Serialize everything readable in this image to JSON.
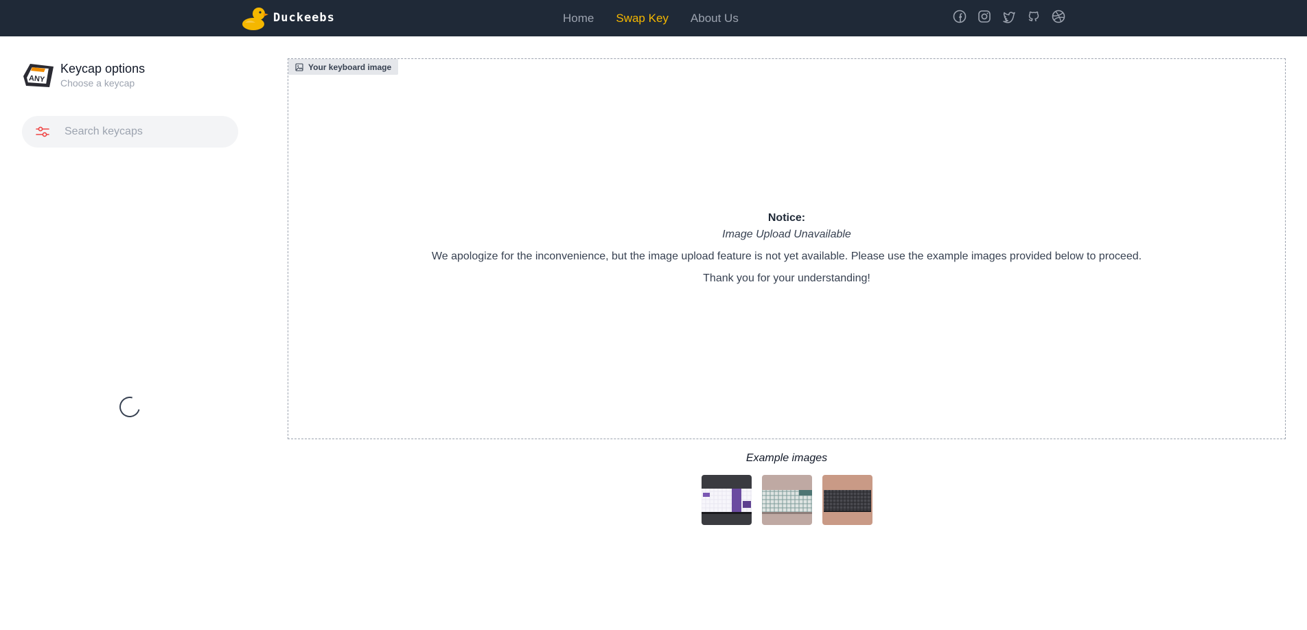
{
  "header": {
    "brand": "Duckeebs",
    "nav": [
      {
        "label": "Home",
        "active": false
      },
      {
        "label": "Swap Key",
        "active": true
      },
      {
        "label": "About Us",
        "active": false
      }
    ],
    "social_icons": [
      "facebook-icon",
      "instagram-icon",
      "twitter-icon",
      "github-icon",
      "dribbble-icon"
    ],
    "colors": {
      "background": "#1f2937",
      "accent": "#f5b700",
      "inactive": "#9ca3af"
    }
  },
  "sidebar": {
    "logo_text": "ANY",
    "title": "Keycap options",
    "subtitle": "Choose a keycap",
    "search": {
      "value": "",
      "placeholder": "Search keycaps"
    },
    "loading": true
  },
  "main": {
    "upload_label": "Your keyboard image",
    "notice_title": "Notice:",
    "notice_subtitle": "Image Upload Unavailable",
    "notice_body": "We apologize for the inconvenience, but the image upload feature is not yet available. Please use the example images provided below to proceed.",
    "notice_thanks": "Thank you for your understanding!"
  },
  "examples": {
    "title": "Example images",
    "items": [
      "purple-white keyboard",
      "grey-teal keyboard",
      "dark keyboard on pink"
    ]
  }
}
